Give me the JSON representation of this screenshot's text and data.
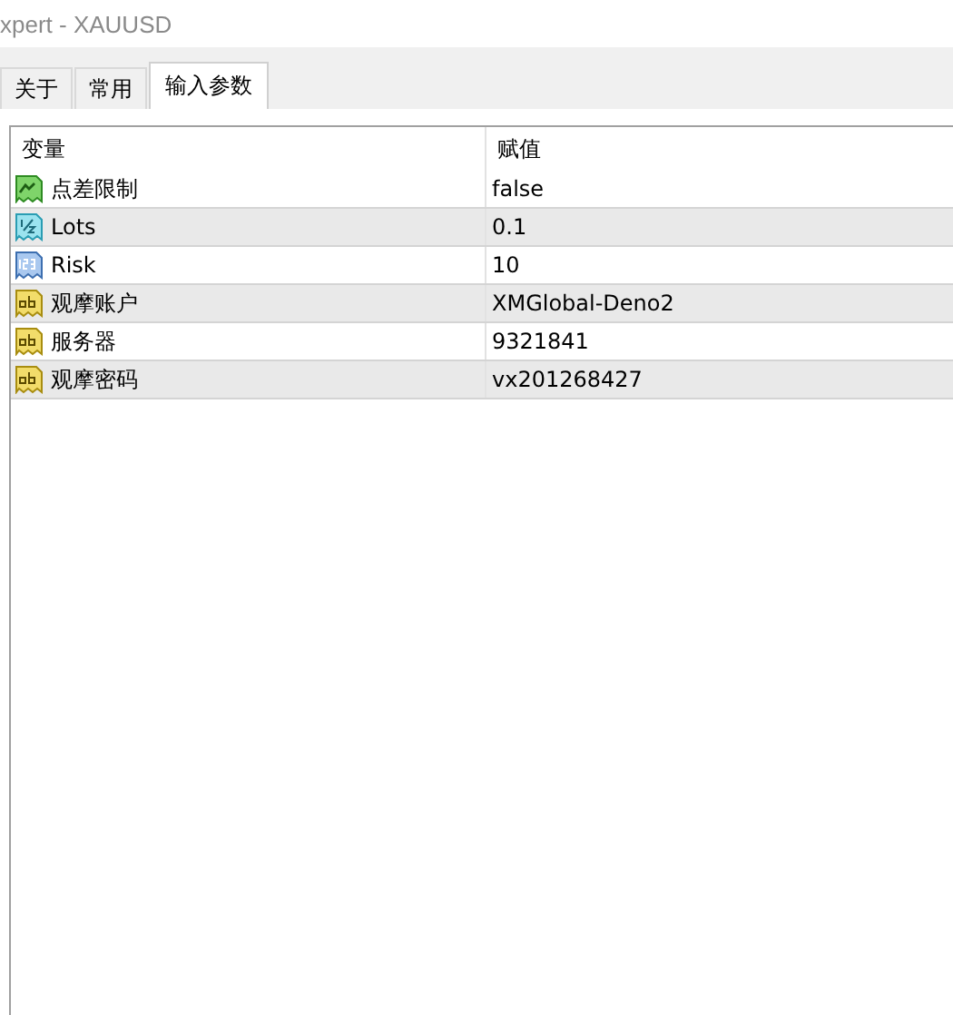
{
  "window": {
    "title": "xpert - XAUUSD"
  },
  "tabs": [
    {
      "label": "关于",
      "selected": false
    },
    {
      "label": "常用",
      "selected": false
    },
    {
      "label": "输入参数",
      "selected": true
    }
  ],
  "table": {
    "columns": [
      "变量",
      "赋值"
    ],
    "rows": [
      {
        "kind": "bool",
        "name": "点差限制",
        "value": "false"
      },
      {
        "kind": "double",
        "name": "Lots",
        "value": "0.1"
      },
      {
        "kind": "int",
        "name": "Risk",
        "value": "10"
      },
      {
        "kind": "string",
        "name": "观摩账户",
        "value": "XMGlobal-Deno2"
      },
      {
        "kind": "string",
        "name": "服务器",
        "value": "9321841"
      },
      {
        "kind": "string",
        "name": "观摩密码",
        "value": "vx201268427"
      }
    ]
  }
}
